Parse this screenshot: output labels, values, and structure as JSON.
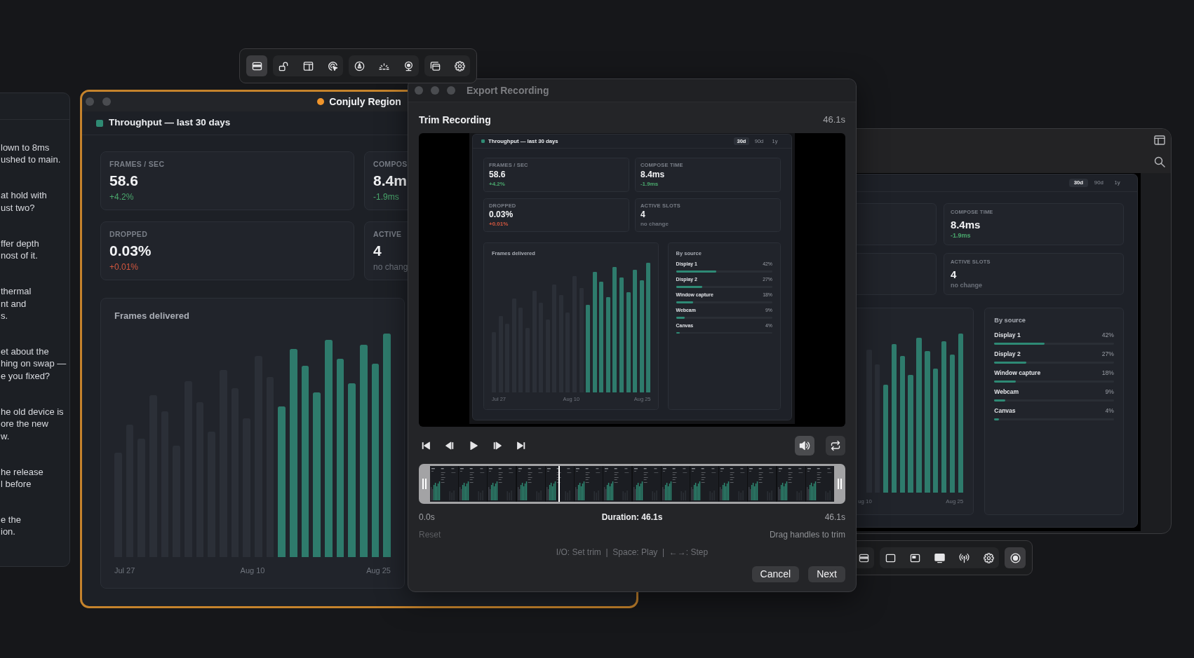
{
  "chat_panel": {
    "messages": [
      {
        "lines": [
          "lown to 8ms",
          "ushed to main."
        ]
      },
      {
        "lines": [
          "at hold with",
          "ust two?"
        ]
      },
      {
        "lines": [
          "ffer depth",
          "nost of it."
        ]
      },
      {
        "lines": [
          "thermal",
          "nt and",
          "s."
        ]
      },
      {
        "lines": [
          "et about the",
          "hing on swap —",
          "e you fixed?"
        ]
      },
      {
        "lines": [
          "he old device is",
          "ore the new",
          "w."
        ]
      },
      {
        "lines": [
          "he release",
          "l before"
        ]
      },
      {
        "lines": [
          "e the",
          "ion."
        ]
      }
    ]
  },
  "capture_toolbar": {
    "groups": [
      [
        {
          "selected": true
        }
      ],
      [
        {
          "selected": false
        },
        {
          "selected": false
        },
        {
          "selected": false
        }
      ],
      [
        {
          "selected": false
        },
        {
          "selected": false
        },
        {
          "selected": false
        }
      ],
      [
        {
          "selected": false
        },
        {
          "selected": false
        }
      ]
    ]
  },
  "region_window": {
    "title": "Conjuly Region",
    "selected": true,
    "dashboard": {
      "title": "Throughput — last 30 days",
      "stats": [
        {
          "label": "FRAMES / SEC",
          "value": "58.6",
          "change": "+4.2%",
          "color": "#4aa86d"
        },
        {
          "label": "COMPOS",
          "value": "8.4m",
          "change": "-1.9ms",
          "color": "#4aa86d"
        },
        {
          "label": "DROPPED",
          "value": "0.03%",
          "change": "+0.01%",
          "color": "#d2573f"
        },
        {
          "label": "ACTIVE",
          "value": "4",
          "change": "no chang",
          "color": "#6d727b"
        }
      ],
      "chart": {
        "title": "Frames delivered",
        "x_labels": [
          "Jul 27",
          "Aug 10",
          "Aug 25"
        ]
      }
    }
  },
  "export_dialog": {
    "title": "Export Recording",
    "heading": "Trim Recording",
    "length": "46.1s",
    "preview": {
      "title": "Throughput — last 30 days",
      "ranges": [
        {
          "label": "30d",
          "selected": true
        },
        {
          "label": "90d",
          "selected": false
        },
        {
          "label": "1y",
          "selected": false
        }
      ],
      "stats": [
        {
          "label": "FRAMES / SEC",
          "value": "58.6",
          "change": "+4.2%",
          "color": "#4aa86d"
        },
        {
          "label": "COMPOSE TIME",
          "value": "8.4ms",
          "change": "-1.9ms",
          "color": "#4aa86d"
        },
        {
          "label": "DROPPED",
          "value": "0.03%",
          "change": "+0.01%",
          "color": "#d2573f"
        },
        {
          "label": "ACTIVE SLOTS",
          "value": "4",
          "change": "no change",
          "color": "#6d727b"
        }
      ],
      "chart": {
        "title": "Frames delivered",
        "x_labels": [
          "Jul 27",
          "Aug 10",
          "Aug 25"
        ]
      },
      "sources": {
        "title": "By source",
        "items": [
          {
            "name": "Display 1",
            "share": "42%",
            "level": 0.42
          },
          {
            "name": "Display 2",
            "share": "27%",
            "level": 0.27
          },
          {
            "name": "Window capture",
            "share": "18%",
            "level": 0.18
          },
          {
            "name": "Webcam",
            "share": "9%",
            "level": 0.09
          },
          {
            "name": "Canvas",
            "share": "4%",
            "level": 0.04
          }
        ]
      }
    },
    "volume": {
      "on": true
    },
    "loop": {
      "on": false
    },
    "trim": {
      "start": "0.0s",
      "duration": "Duration: 46.1s",
      "end": "46.1s",
      "playhead": {
        "level": 0.32
      }
    },
    "reset": {
      "label": "Reset",
      "disabled": true
    },
    "hint": "Drag handles to trim",
    "shortcuts": "I/O: Set trim  |  Space: Play  |  ←→: Step",
    "buttons": [
      "Cancel",
      "Next"
    ]
  },
  "display_window": {
    "dashboard": {
      "ranges": [
        {
          "label": "30d",
          "selected": true
        },
        {
          "label": "90d",
          "selected": false
        },
        {
          "label": "1y",
          "selected": false
        }
      ],
      "stats": [
        {
          "label": "COMPOSE TIME",
          "value": "8.4ms",
          "change": "-1.9ms",
          "color": "#4aa86d"
        },
        {
          "label": "ACTIVE SLOTS",
          "value": "4",
          "change": "no change",
          "color": "#6d727b"
        }
      ],
      "chart": {
        "x_labels": [
          "ug 10",
          "Aug 25"
        ]
      },
      "sources": {
        "title": "By source",
        "items": [
          {
            "name": "Display 1",
            "share": "42%",
            "level": 0.42
          },
          {
            "name": "Display 2",
            "share": "27%",
            "level": 0.27
          },
          {
            "name": "Window capture",
            "share": "18%",
            "level": 0.18
          },
          {
            "name": "Webcam",
            "share": "9%",
            "level": 0.09
          },
          {
            "name": "Canvas",
            "share": "4%",
            "level": 0.04
          }
        ]
      }
    }
  },
  "source_toolbar": {
    "groups": [
      [
        {
          "selected": false
        }
      ],
      [
        {
          "selected": false
        },
        {
          "selected": false
        },
        {
          "selected": false
        },
        {
          "selected": false
        },
        {
          "selected": false
        }
      ],
      [
        {
          "selected": true
        }
      ]
    ]
  }
}
